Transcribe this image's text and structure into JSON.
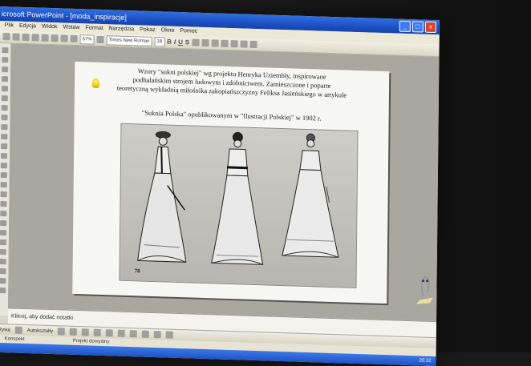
{
  "window": {
    "title": "icrosoft PowerPoint - [moda_inspiracje]",
    "buttons": [
      "_",
      "□",
      "x"
    ]
  },
  "menu": [
    "Plik",
    "Edycja",
    "Widok",
    "Wstaw",
    "Format",
    "Narzędzia",
    "Pokaz",
    "Okno",
    "Pomoc"
  ],
  "toolbar": {
    "zoom": "57%",
    "font": "Times New Roman",
    "font_size": "18",
    "bold": "B",
    "italic": "I",
    "underline": "U",
    "shadow": "S"
  },
  "slide": {
    "line1": "Wzory \"sukni polskiej\" wg projektu Henryka Uziembły, inspirowane",
    "line2": "podhalańskim strojem ludowym i zdobnictwem. Zamieszczone i poparte",
    "line3": "teoretyczną wykładnią miłośnika zakopiańszczyzny Feliksa Jasieńskiego w artykule",
    "caption": "\"Suknia Polska\" opublikowanym w \"Ilustracji Polskiej\" w 1902 r.",
    "figure_number": "78"
  },
  "notes": {
    "placeholder": "Kliknij, aby dodać notatki"
  },
  "drawbar": {
    "draw": "Rysuj",
    "autoshapes": "Autokształty"
  },
  "statusbar": {
    "slide": "Konspekt",
    "design": "Projekt domyślny"
  },
  "taskbar": {
    "clock": "20:22"
  }
}
